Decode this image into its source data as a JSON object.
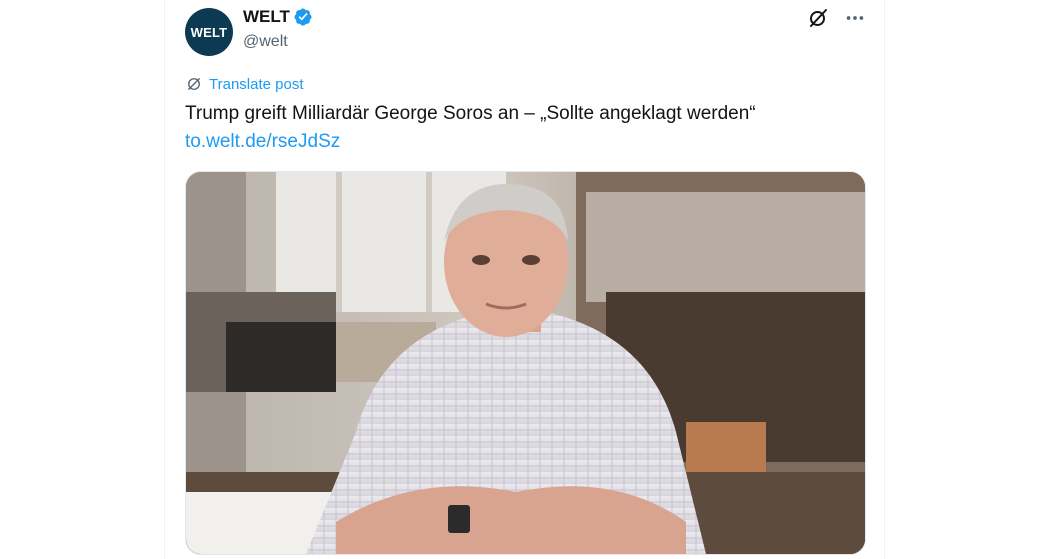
{
  "post": {
    "author": {
      "name": "WELT",
      "handle": "@welt",
      "avatar_text": "WELT",
      "verified": true
    },
    "translate_label": "Translate post",
    "text": "Trump greift Milliardär George Soros an – „Sollte angeklagt werden“",
    "link": "to.welt.de/rseJdSz",
    "icons": {
      "verified": "verified-badge-icon",
      "grok": "grok-icon",
      "more": "more-icon",
      "translate": "translate-icon"
    },
    "colors": {
      "accent": "#1d9bf0",
      "text": "#0f1419",
      "secondary": "#536471",
      "avatar_bg": "#0b3a52"
    }
  }
}
